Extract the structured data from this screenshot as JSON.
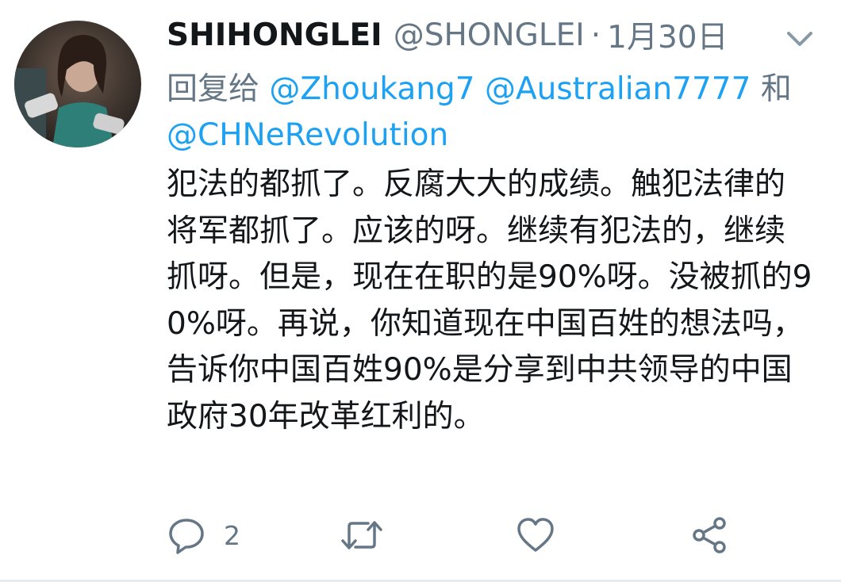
{
  "tweet": {
    "display_name": "SHIHONGLEI",
    "handle": "@SHONGLEI",
    "separator": "·",
    "date": "1月30日",
    "reply_prefix": "回复给",
    "mention_1": "@Zhoukang7",
    "mention_2": "@Australian7777",
    "conjunction": "和",
    "mention_3": "@CHNeRevolution",
    "text": "犯法的都抓了。反腐大大的成绩。触犯法律的将军都抓了。应该的呀。继续有犯法的，继续抓呀。但是，现在在职的是90%呀。没被抓的90%呀。再说，你知道现在中国百姓的想法吗，告诉你中国百姓90%是分享到中共领导的中国政府30年改革红利的。"
  },
  "actions": {
    "reply_icon": "reply-bubble-icon",
    "reply_count": "2",
    "retweet_icon": "retweet-icon",
    "like_icon": "heart-icon",
    "share_icon": "share-icon"
  },
  "colors": {
    "text": "#14171a",
    "secondary": "#657786",
    "link": "#1da1f2"
  }
}
